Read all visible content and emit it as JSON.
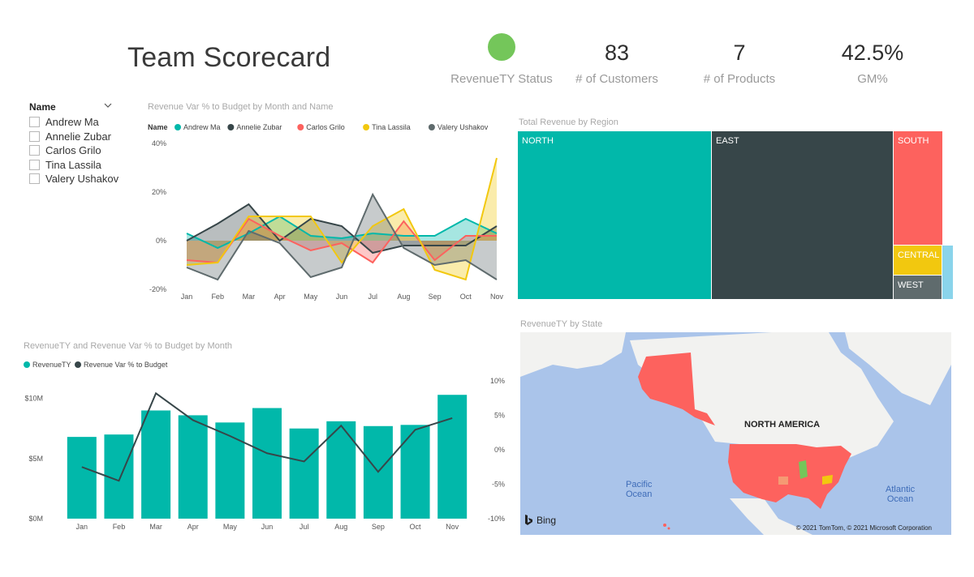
{
  "header": {
    "title": "Team Scorecard",
    "status_label": "RevenueTY Status",
    "status_color": "#74c65a",
    "kpis": [
      {
        "value": "83",
        "label": "# of Customers"
      },
      {
        "value": "7",
        "label": "# of Products"
      },
      {
        "value": "42.5%",
        "label": "GM%"
      }
    ]
  },
  "slicer": {
    "title": "Name",
    "items": [
      "Andrew Ma",
      "Annelie Zubar",
      "Carlos Grilo",
      "Tina Lassila",
      "Valery Ushakov"
    ]
  },
  "chart_data": [
    {
      "type": "area",
      "title": "Revenue Var % to Budget by Month and Name",
      "legend_title": "Name",
      "legend_position": "top-left",
      "categories": [
        "Jan",
        "Feb",
        "Mar",
        "Apr",
        "May",
        "Jun",
        "Jul",
        "Aug",
        "Sep",
        "Oct",
        "Nov"
      ],
      "ylim": [
        -20,
        40
      ],
      "yticks": [
        "40%",
        "20%",
        "0%",
        "-20%"
      ],
      "grid": false,
      "series": [
        {
          "name": "Andrew Ma",
          "color": "#01b8aa",
          "values": [
            3,
            -3,
            3,
            10,
            2,
            1,
            3,
            2,
            2,
            9,
            3
          ]
        },
        {
          "name": "Annelie Zubar",
          "color": "#374649",
          "values": [
            0,
            7,
            15,
            0,
            9,
            6,
            -5,
            -2,
            -2,
            -2,
            6
          ]
        },
        {
          "name": "Carlos Grilo",
          "color": "#fd625e",
          "values": [
            -8,
            -9,
            9,
            2,
            -4,
            -1,
            -9,
            8,
            -8,
            2,
            2
          ]
        },
        {
          "name": "Tina Lassila",
          "color": "#f2c80f",
          "values": [
            -10,
            -9,
            10,
            10,
            10,
            -9,
            6,
            13,
            -12,
            -16,
            34
          ]
        },
        {
          "name": "Valery Ushakov",
          "color": "#5f6b6d",
          "values": [
            -11,
            -16,
            4,
            -1,
            -15,
            -11,
            19,
            -3,
            -10,
            -8,
            -16
          ]
        }
      ]
    },
    {
      "type": "bar",
      "title": "RevenueTY and Revenue Var % to Budget by Month",
      "legend_position": "top-left",
      "categories": [
        "Jan",
        "Feb",
        "Mar",
        "Apr",
        "May",
        "Jun",
        "Jul",
        "Aug",
        "Sep",
        "Oct",
        "Nov"
      ],
      "ylim": [
        0,
        12
      ],
      "y2lim": [
        -10,
        10
      ],
      "yticks": [
        "$10M",
        "$5M",
        "$0M"
      ],
      "y2ticks": [
        "10%",
        "5%",
        "0%",
        "-5%",
        "-10%"
      ],
      "series": [
        {
          "name": "RevenueTY",
          "color": "#01b8aa",
          "values": [
            6.8,
            7.0,
            9.0,
            8.6,
            8.0,
            9.2,
            7.5,
            8.1,
            7.7,
            7.8,
            10.3
          ],
          "unit": "$M"
        },
        {
          "name": "Revenue Var % to Budget",
          "color": "#374649",
          "type": "line",
          "values": [
            -2.5,
            -4.5,
            8.2,
            4.3,
            2.0,
            -0.5,
            -1.7,
            3.5,
            -3.2,
            2.9,
            4.6
          ],
          "unit": "%"
        }
      ]
    },
    {
      "type": "treemap",
      "title": "Total Revenue by Region",
      "categories": [
        "NORTH",
        "EAST",
        "SOUTH",
        "CENTRAL",
        "WEST"
      ],
      "colors": [
        "#01b8aa",
        "#374649",
        "#fd625e",
        "#f2c80f",
        "#5f6b6d",
        "#8ad4eb"
      ]
    }
  ],
  "map": {
    "title": "RevenueTY by State",
    "labels": {
      "continent": "NORTH AMERICA",
      "pacific": "Pacific\nOcean",
      "atlantic": "Atlantic\nOcean"
    },
    "brand": "Bing",
    "copyright": "© 2021 TomTom, © 2021 Microsoft Corporation"
  }
}
